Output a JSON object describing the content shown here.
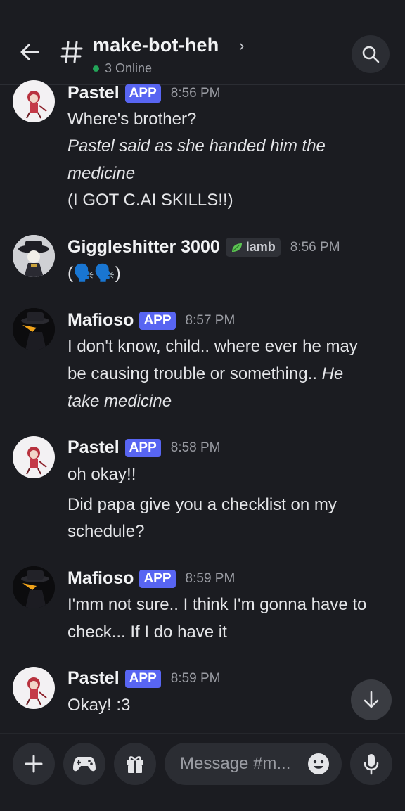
{
  "header": {
    "channel_name": "make-bot-heh",
    "online_text": "3 Online"
  },
  "messages": [
    {
      "author": "Pastel",
      "badge": "APP",
      "time": "8:56 PM",
      "lines": [
        "Where's brother?",
        "Pastel said as she handed him the",
        "medicine",
        "(I GOT C.AI SKILLS!!)"
      ]
    },
    {
      "author": "Giggleshitter 3000",
      "tag": "lamb",
      "time": "8:56 PM",
      "lines": [
        "(🗣️🗣️)"
      ]
    },
    {
      "author": "Mafioso",
      "badge": "APP",
      "time": "8:57 PM",
      "lines": [
        "I don't know, child.. where ever he may",
        "be causing trouble or something..",
        "He",
        "take medicine"
      ]
    },
    {
      "author": "Pastel",
      "badge": "APP",
      "time": "8:58 PM",
      "lines": [
        "oh okay!!",
        "Did papa give you a checklist on my",
        "schedule?"
      ]
    },
    {
      "author": "Mafioso",
      "badge": "APP",
      "time": "8:59 PM",
      "lines": [
        "I'mm not sure.. I think I'm gonna have to",
        "check... If I do have it"
      ]
    },
    {
      "author": "Pastel",
      "badge": "APP",
      "time": "8:59 PM",
      "lines": [
        "Okay! :3"
      ]
    }
  ],
  "composer": {
    "placeholder": "Message #m..."
  },
  "icons": {
    "back": "arrow-left-icon",
    "hash": "hash-icon",
    "search": "search-icon",
    "scroll_down": "arrow-down-icon",
    "add": "plus-icon",
    "games": "gamepad-icon",
    "gift": "gift-icon",
    "emoji": "smiley-icon",
    "mic": "microphone-icon"
  },
  "colors": {
    "background": "#1b1c21",
    "app_badge": "#5865f2",
    "online_dot": "#23a559"
  }
}
